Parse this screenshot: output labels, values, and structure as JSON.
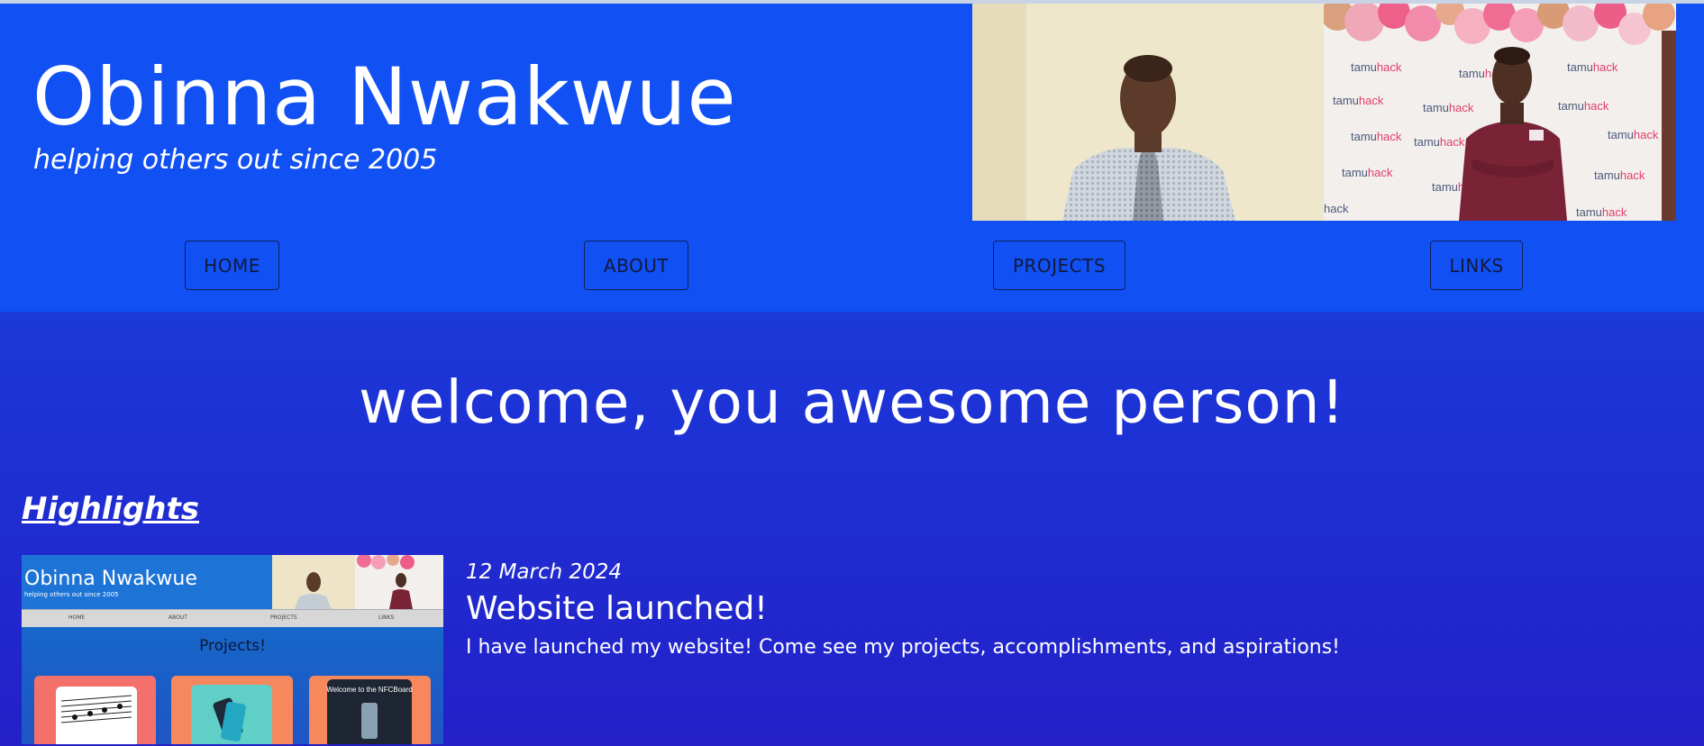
{
  "header": {
    "title": "Obinna Nwakwue",
    "tagline": "helping others out since 2005",
    "photo_banner_text": "tamuhack"
  },
  "nav": {
    "home": "HOME",
    "about": "ABOUT",
    "projects": "PROJECTS",
    "links": "LINKS"
  },
  "main": {
    "welcome": "welcome, you awesome person!",
    "highlights_heading": "Highlights"
  },
  "highlight": {
    "date": "12 March 2024",
    "title": "Website launched!",
    "body": "I have launched my website! Come see my projects, accomplishments, and aspirations!",
    "thumbnail": {
      "title": "Obinna Nwakwue",
      "tagline": "helping others out since 2005",
      "nav": [
        "HOME",
        "ABOUT",
        "PROJECTS",
        "LINKS"
      ],
      "section": "Projects!",
      "card_caption": "Welcome to the NFCBoard"
    }
  },
  "colors": {
    "header_bg": "#1150f3",
    "main_bg": "#1b35d6",
    "text": "#ffffff",
    "nav_border": "#10205a"
  }
}
